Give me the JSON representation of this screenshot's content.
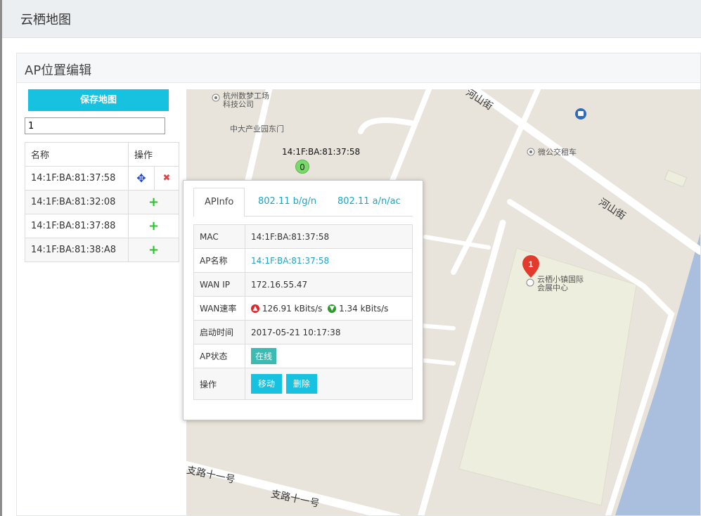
{
  "app": {
    "title": "云栖地图"
  },
  "panel": {
    "title": "AP位置编辑"
  },
  "sidebar": {
    "save_label": "保存地图",
    "search_value": "1",
    "table": {
      "headers": [
        "名称",
        "操作"
      ],
      "rows": [
        {
          "name": "14:1F:BA:81:37:58",
          "actions": [
            "move-icon",
            "delete-icon"
          ]
        },
        {
          "name": "14:1F:BA:81:32:08",
          "actions": [
            "add-icon"
          ]
        },
        {
          "name": "14:1F:BA:81:37:88",
          "actions": [
            "add-icon"
          ]
        },
        {
          "name": "14:1F:BA:81:38:A8",
          "actions": [
            "add-icon"
          ]
        }
      ]
    }
  },
  "map": {
    "labels": {
      "poi1_line1": "杭州数梦工场",
      "poi1_line2": "科技公司",
      "poi2": "中大产业园东门",
      "poi3": "微公交租车",
      "poi4_line1": "云栖小镇国际",
      "poi4_line2": "会展中心",
      "road1": "河山街",
      "road2": "河山街",
      "road3": "支路十一号",
      "road4": "支路十一号"
    },
    "ap_marker": {
      "label": "14:1F:BA:81:37:58",
      "count": "0"
    },
    "pin_number": "1",
    "colors": {
      "land": "#e8e4db",
      "road": "#ffffff",
      "block": "#eeeede",
      "water": "#a9bfdd",
      "pin": "#e23b2e"
    }
  },
  "popup": {
    "tabs": [
      "APInfo",
      "802.11 b/g/n",
      "802.11 a/n/ac"
    ],
    "active_tab": "APInfo",
    "rows": {
      "mac_label": "MAC",
      "mac_value": "14:1F:BA:81:37:58",
      "name_label": "AP名称",
      "name_value": "14:1F:BA:81:37:58",
      "wan_ip_label": "WAN IP",
      "wan_ip_value": "172.16.55.47",
      "wan_speed_label": "WAN速率",
      "up_speed": "126.91 kBits/s",
      "down_speed": "1.34 kBits/s",
      "boot_label": "启动时间",
      "boot_value": "2017-05-21 10:17:38",
      "status_label": "AP状态",
      "status_value": "在线",
      "op_label": "操作",
      "move_label": "移动",
      "delete_label": "删除"
    }
  }
}
